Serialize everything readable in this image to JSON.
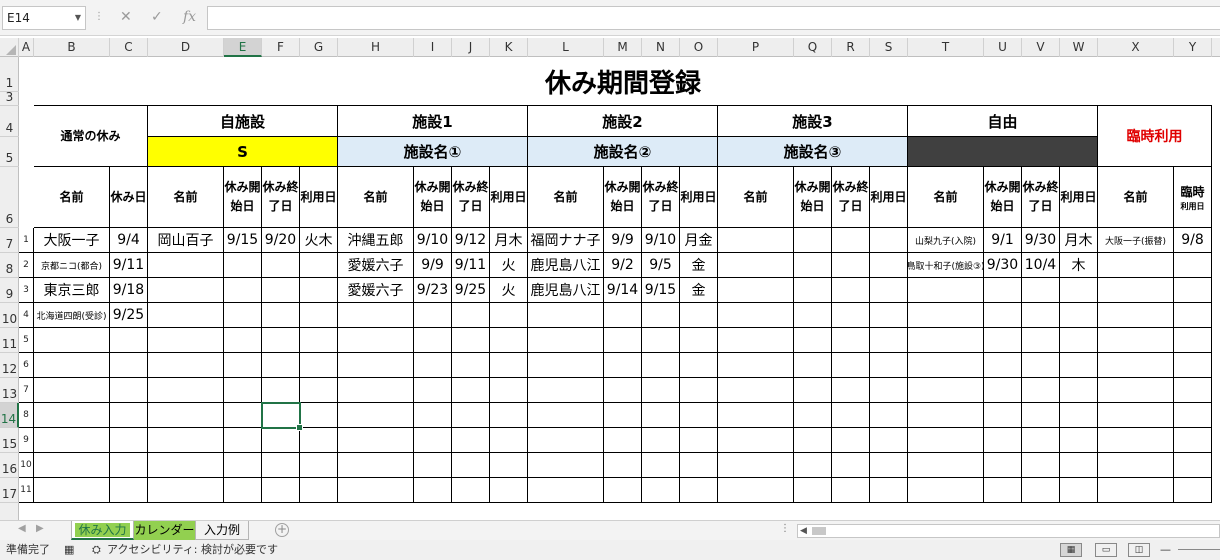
{
  "formula_bar": {
    "name_box": "E14",
    "cancel_icon": "✕",
    "enter_icon": "✓",
    "fx_label": "fx",
    "formula": ""
  },
  "columns": [
    "A",
    "B",
    "C",
    "D",
    "E",
    "F",
    "G",
    "H",
    "I",
    "J",
    "K",
    "L",
    "M",
    "N",
    "O",
    "P",
    "Q",
    "R",
    "S",
    "T",
    "U",
    "V",
    "W",
    "X",
    "Y"
  ],
  "rows": [
    "1",
    "3",
    "4",
    "5",
    "6",
    "7",
    "8",
    "9",
    "10",
    "11",
    "12",
    "13",
    "14",
    "15",
    "16",
    "17"
  ],
  "sheet": {
    "title": "休み期間登録",
    "normal_holiday": "通常の休み",
    "own_facility": "自施設",
    "facility1": "施設1",
    "facility2": "施設2",
    "facility3": "施設3",
    "free": "自由",
    "temporary": "臨時利用",
    "own_code": "S",
    "facility1_name": "施設名①",
    "facility2_name": "施設名②",
    "facility3_name": "施設名③",
    "h_name": "名前",
    "h_rest_day": "休み日",
    "h_start": "休み開始日",
    "h_end": "休み終了日",
    "h_use": "利用日",
    "h_temp_line1": "臨時",
    "h_temp_line2": "利用日"
  },
  "row_numbers": [
    "1",
    "2",
    "3",
    "4",
    "5",
    "6",
    "7",
    "8",
    "9",
    "10",
    "11"
  ],
  "data_rows": [
    {
      "name": "大阪一子",
      "rest": "9/4",
      "own": [
        "岡山百子",
        "9/15",
        "9/20",
        "火木"
      ],
      "f1": [
        "沖縄五郎",
        "9/10",
        "9/12",
        "月木"
      ],
      "f2": [
        "福岡ナナ子",
        "9/9",
        "9/10",
        "月金"
      ],
      "f3": [
        "",
        "",
        "",
        ""
      ],
      "free": [
        "山梨九子(入院)",
        "9/1",
        "9/30",
        "月木"
      ],
      "temp": [
        "大阪一子(振替)",
        "9/8"
      ]
    },
    {
      "name": "京都ニコ(都合)",
      "rest": "9/11",
      "own": [
        "",
        "",
        "",
        ""
      ],
      "f1": [
        "愛媛六子",
        "9/9",
        "9/11",
        "火"
      ],
      "f2": [
        "鹿児島八江",
        "9/2",
        "9/5",
        "金"
      ],
      "f3": [
        "",
        "",
        "",
        ""
      ],
      "free": [
        "鳥取十和子(施設③)",
        "9/30",
        "10/4",
        "木"
      ],
      "temp": [
        "",
        ""
      ]
    },
    {
      "name": "東京三郎",
      "rest": "9/18",
      "own": [
        "",
        "",
        "",
        ""
      ],
      "f1": [
        "愛媛六子",
        "9/23",
        "9/25",
        "火"
      ],
      "f2": [
        "鹿児島八江",
        "9/14",
        "9/15",
        "金"
      ],
      "f3": [
        "",
        "",
        "",
        ""
      ],
      "free": [
        "",
        "",
        "",
        ""
      ],
      "temp": [
        "",
        ""
      ]
    },
    {
      "name": "北海道四朗(受診)",
      "rest": "9/25",
      "own": [
        "",
        "",
        "",
        ""
      ],
      "f1": [
        "",
        "",
        "",
        ""
      ],
      "f2": [
        "",
        "",
        "",
        ""
      ],
      "f3": [
        "",
        "",
        "",
        ""
      ],
      "free": [
        "",
        "",
        "",
        ""
      ],
      "temp": [
        "",
        ""
      ]
    }
  ],
  "tabs": [
    "休み入力",
    "カレンダー",
    "入力例"
  ],
  "add_sheet": "+",
  "status": {
    "ready": "準備完了",
    "accessibility": "アクセシビリティ: 検討が必要です"
  },
  "colors": {
    "accent": "#217346",
    "yellow": "#ffff00",
    "light_blue": "#ddebf7",
    "dark": "#404040",
    "red": "#e00000",
    "tab_green": "#92d050"
  }
}
